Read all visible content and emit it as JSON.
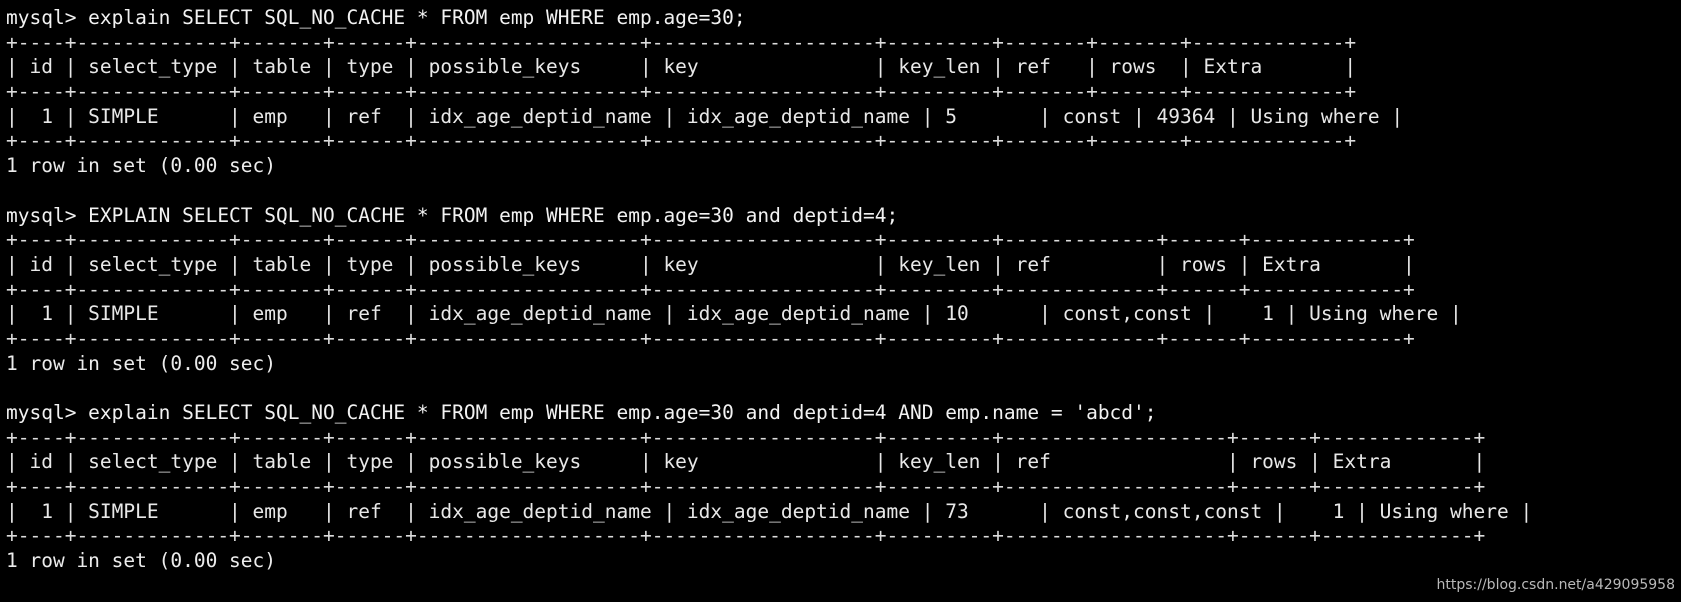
{
  "terminal": {
    "prompt": "mysql> ",
    "background_color": "#000000",
    "text_color": "#e8e8e8",
    "watermark": "https://blog.csdn.net/a429095958"
  },
  "blocks": [
    {
      "id": "block-1",
      "command": "mysql> explain SELECT SQL_NO_CACHE * FROM emp WHERE emp.age=30;",
      "separator_top": "+----+-------------+-------+------+-------------------+-------------------+---------+-------+-------+-------------+",
      "header_row": "| id | select_type | table | type | possible_keys     | key               | key_len | ref   | rows  | Extra       |",
      "separator_mid": "+----+-------------+-------+------+-------------------+-------------------+---------+-------+-------+-------------+",
      "data_row": "|  1 | SIMPLE      | emp   | ref  | idx_age_deptid_name | idx_age_deptid_name | 5       | const | 49364 | Using where |",
      "separator_bottom": "+----+-------------+-------+------+-------------------+-------------------+---------+-------+-------+-------------+",
      "status": "1 row in set (0.00 sec)",
      "columns": [
        "id",
        "select_type",
        "table",
        "type",
        "possible_keys",
        "key",
        "key_len",
        "ref",
        "rows",
        "Extra"
      ],
      "values": {
        "id": "1",
        "select_type": "SIMPLE",
        "table": "emp",
        "type": "ref",
        "possible_keys": "idx_age_deptid_name",
        "key": "idx_age_deptid_name",
        "key_len": "5",
        "ref": "const",
        "rows": "49364",
        "Extra": "Using where"
      }
    },
    {
      "id": "block-2",
      "command": "mysql> EXPLAIN SELECT SQL_NO_CACHE * FROM emp WHERE emp.age=30 and deptid=4;",
      "separator_top": "+----+-------------+-------+------+-------------------+-------------------+---------+-------------+------+-------------+",
      "header_row": "| id | select_type | table | type | possible_keys     | key               | key_len | ref         | rows | Extra       |",
      "separator_mid": "+----+-------------+-------+------+-------------------+-------------------+---------+-------------+------+-------------+",
      "data_row": "|  1 | SIMPLE      | emp   | ref  | idx_age_deptid_name | idx_age_deptid_name | 10      | const,const |    1 | Using where |",
      "separator_bottom": "+----+-------------+-------+------+-------------------+-------------------+---------+-------------+------+-------------+",
      "status": "1 row in set (0.00 sec)",
      "columns": [
        "id",
        "select_type",
        "table",
        "type",
        "possible_keys",
        "key",
        "key_len",
        "ref",
        "rows",
        "Extra"
      ],
      "values": {
        "id": "1",
        "select_type": "SIMPLE",
        "table": "emp",
        "type": "ref",
        "possible_keys": "idx_age_deptid_name",
        "key": "idx_age_deptid_name",
        "key_len": "10",
        "ref": "const,const",
        "rows": "1",
        "Extra": "Using where"
      }
    },
    {
      "id": "block-3",
      "command": "mysql> explain SELECT SQL_NO_CACHE * FROM emp WHERE emp.age=30 and deptid=4 AND emp.name = 'abcd';",
      "separator_top": "+----+-------------+-------+------+-------------------+-------------------+---------+-------------------+------+-------------+",
      "header_row": "| id | select_type | table | type | possible_keys     | key               | key_len | ref               | rows | Extra       |",
      "separator_mid": "+----+-------------+-------+------+-------------------+-------------------+---------+-------------------+------+-------------+",
      "data_row": "|  1 | SIMPLE      | emp   | ref  | idx_age_deptid_name | idx_age_deptid_name | 73      | const,const,const |    1 | Using where |",
      "separator_bottom": "+----+-------------+-------+------+-------------------+-------------------+---------+-------------------+------+-------------+",
      "status": "1 row in set (0.00 sec)",
      "columns": [
        "id",
        "select_type",
        "table",
        "type",
        "possible_keys",
        "key",
        "key_len",
        "ref",
        "rows",
        "Extra"
      ],
      "values": {
        "id": "1",
        "select_type": "SIMPLE",
        "table": "emp",
        "type": "ref",
        "possible_keys": "idx_age_deptid_name",
        "key": "idx_age_deptid_name",
        "key_len": "73",
        "ref": "const,const,const",
        "rows": "1",
        "Extra": "Using where"
      }
    }
  ]
}
